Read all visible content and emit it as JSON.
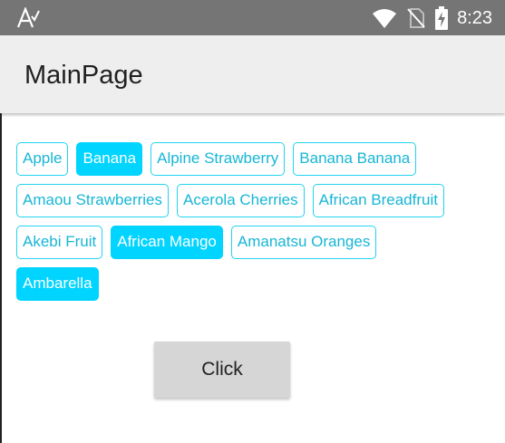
{
  "status_bar": {
    "time": "8:23",
    "icons": [
      "autofill-a-icon",
      "wifi-icon",
      "no-sim-icon",
      "battery-charging-icon"
    ]
  },
  "app_bar": {
    "title": "MainPage"
  },
  "chips": {
    "row1": [
      {
        "label": "Apple",
        "selected": false
      },
      {
        "label": "Banana",
        "selected": true
      },
      {
        "label": "Alpine Strawberry",
        "selected": false
      },
      {
        "label": "Banana Banana",
        "selected": false
      }
    ],
    "row2": [
      {
        "label": "Amaou Strawberries",
        "selected": false
      },
      {
        "label": "Acerola Cherries",
        "selected": false
      },
      {
        "label": "African Breadfruit",
        "selected": false
      }
    ],
    "row3": [
      {
        "label": "Akebi Fruit",
        "selected": false
      },
      {
        "label": "African Mango",
        "selected": true
      },
      {
        "label": "Amanatsu Oranges",
        "selected": false
      }
    ],
    "row4": [
      {
        "label": "Ambarella",
        "selected": true
      }
    ]
  },
  "button": {
    "label": "Click"
  },
  "colors": {
    "chip_accent": "#00d4ff",
    "status_bar": "#757575",
    "app_bar": "#eeeeee",
    "button": "#d6d6d6"
  }
}
